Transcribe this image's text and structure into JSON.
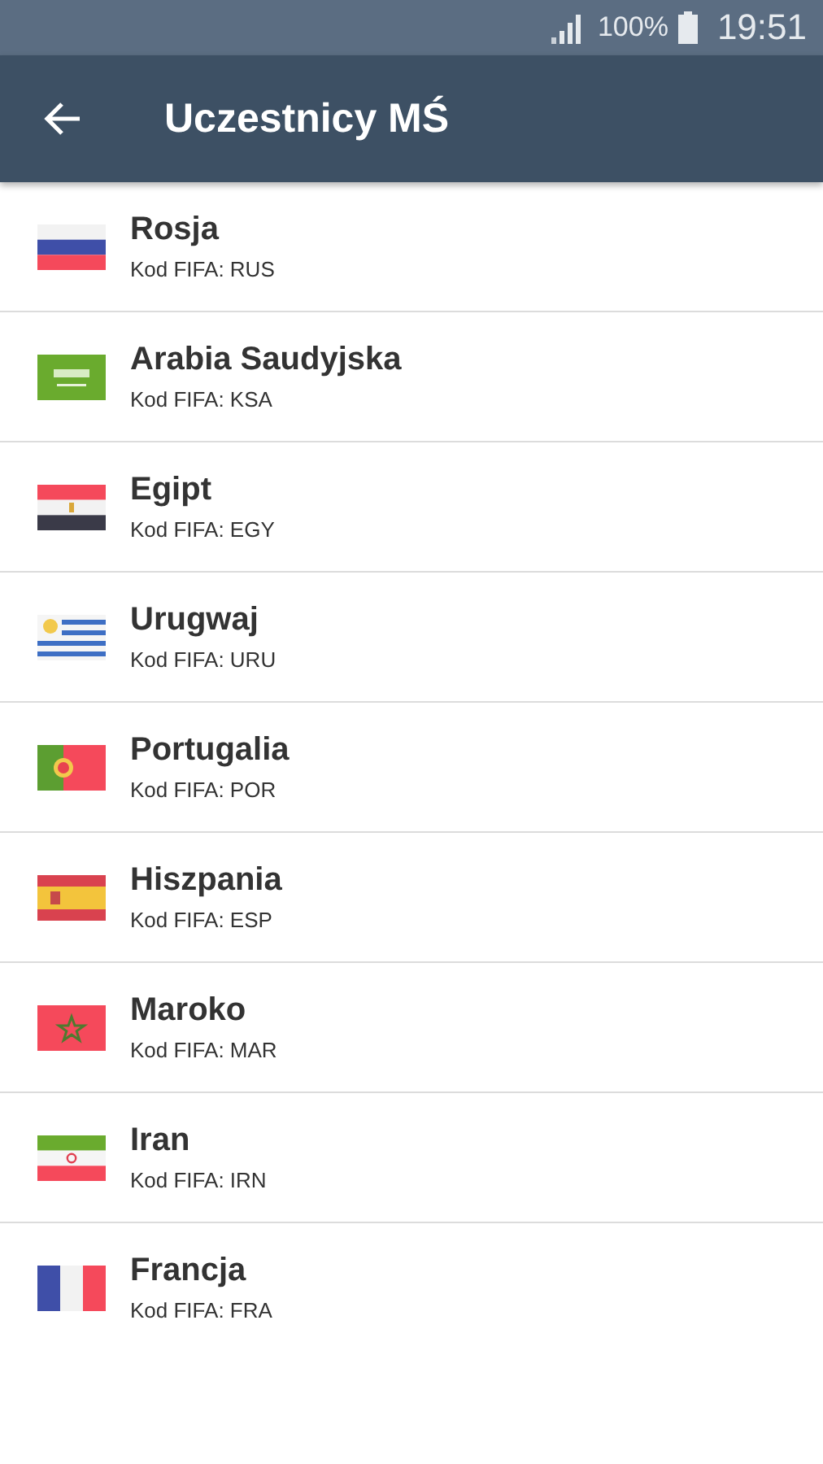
{
  "status_bar": {
    "battery": "100%",
    "time": "19:51"
  },
  "app_bar": {
    "title": "Uczestnicy MŚ"
  },
  "teams": [
    {
      "name": "Rosja",
      "code": "Kod FIFA: RUS",
      "kind": "rus"
    },
    {
      "name": "Arabia Saudyjska",
      "code": "Kod FIFA: KSA",
      "kind": "ksa"
    },
    {
      "name": "Egipt",
      "code": "Kod FIFA: EGY",
      "kind": "egy"
    },
    {
      "name": "Urugwaj",
      "code": "Kod FIFA: URU",
      "kind": "uru"
    },
    {
      "name": "Portugalia",
      "code": "Kod FIFA: POR",
      "kind": "por"
    },
    {
      "name": "Hiszpania",
      "code": "Kod FIFA: ESP",
      "kind": "esp"
    },
    {
      "name": "Maroko",
      "code": "Kod FIFA: MAR",
      "kind": "mar"
    },
    {
      "name": "Iran",
      "code": "Kod FIFA: IRN",
      "kind": "irn"
    },
    {
      "name": "Francja",
      "code": "Kod FIFA: FRA",
      "kind": "fra"
    }
  ]
}
